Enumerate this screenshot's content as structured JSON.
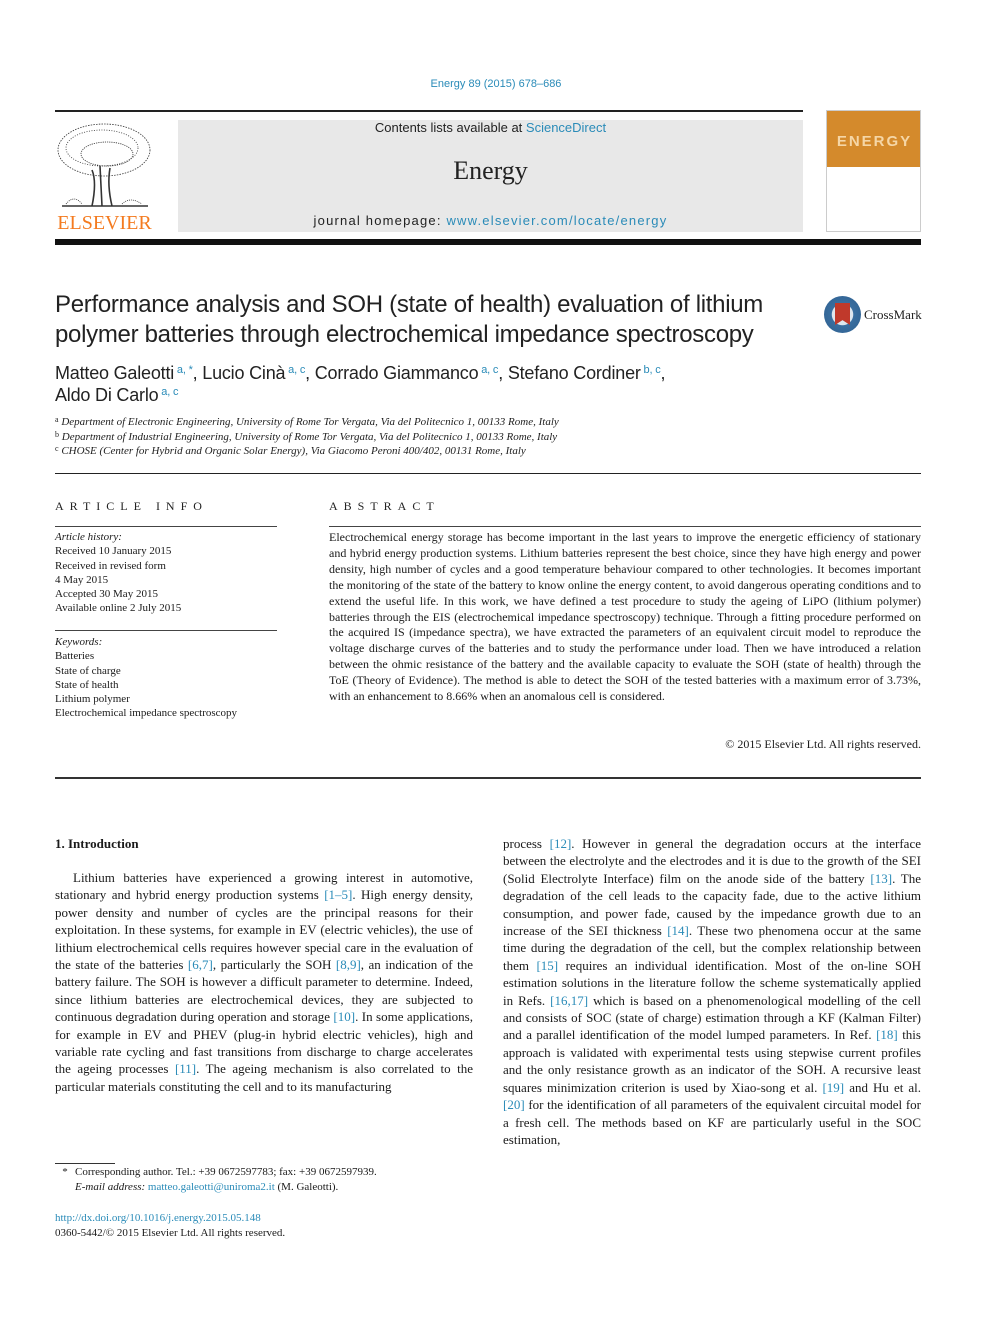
{
  "header": {
    "citation": "Energy 89 (2015) 678–686",
    "contents_prefix": "Contents lists available at ",
    "contents_link": "ScienceDirect",
    "journal_name": "Energy",
    "homepage_prefix": "journal homepage: ",
    "homepage_link": "www.elsevier.com/locate/energy",
    "publisher_logo_text": "ELSEVIER",
    "cover_title": "ENERGY",
    "crossmark_label": "CrossMark",
    "colors": {
      "link": "#2a8bb8",
      "elsevier_orange": "#f47b20",
      "cover_orange": "#d48a2c",
      "masthead_gray": "#e8e8e8"
    }
  },
  "article": {
    "title": "Performance analysis and SOH (state of health) evaluation of lithium polymer batteries through electrochemical impedance spectroscopy",
    "authors": [
      {
        "name": "Matteo Galeotti",
        "sup": "a, *",
        "sep": ", "
      },
      {
        "name": "Lucio Cinà",
        "sup": "a, c",
        "sep": ", "
      },
      {
        "name": "Corrado Giammanco",
        "sup": "a, c",
        "sep": ", "
      },
      {
        "name": "Stefano Cordiner",
        "sup": "b, c",
        "sep": ","
      },
      {
        "name": "Aldo Di Carlo",
        "sup": "a, c",
        "sep": ""
      }
    ],
    "affiliations": [
      {
        "key": "a",
        "text": "Department of Electronic Engineering, University of Rome Tor Vergata, Via del Politecnico 1, 00133 Rome, Italy"
      },
      {
        "key": "b",
        "text": "Department of Industrial Engineering, University of Rome Tor Vergata, Via del Politecnico 1, 00133 Rome, Italy"
      },
      {
        "key": "c",
        "text": "CHOSE (Center for Hybrid and Organic Solar Energy), Via Giacomo Peroni 400/402, 00131 Rome, Italy"
      }
    ]
  },
  "article_info": {
    "heading": "ARTICLE INFO",
    "history_label": "Article history:",
    "history": [
      "Received 10 January 2015",
      "Received in revised form",
      "4 May 2015",
      "Accepted 30 May 2015",
      "Available online 2 July 2015"
    ],
    "keywords_label": "Keywords:",
    "keywords": [
      "Batteries",
      "State of charge",
      "State of health",
      "Lithium polymer",
      "Electrochemical impedance spectroscopy"
    ]
  },
  "abstract": {
    "heading": "ABSTRACT",
    "text": "Electrochemical energy storage has become important in the last years to improve the energetic efficiency of stationary and hybrid energy production systems. Lithium batteries represent the best choice, since they have high energy and power density, high number of cycles and a good temperature behaviour compared to other technologies. It becomes important the monitoring of the state of the battery to know online the energy content, to avoid dangerous operating conditions and to extend the useful life. In this work, we have defined a test procedure to study the ageing of LiPO (lithium polymer) batteries through the EIS (electrochemical impedance spectroscopy) technique. Through a fitting procedure performed on the acquired IS (impedance spectra), we have extracted the parameters of an equivalent circuit model to reproduce the voltage discharge curves of the batteries and to study the performance under load. Then we have introduced a relation between the ohmic resistance of the battery and the available capacity to evaluate the SOH (state of health) through the ToE (Theory of Evidence). The method is able to detect the SOH of the tested batteries with a maximum error of 3.73%, with an enhancement to 8.66% when an anomalous cell is considered.",
    "copyright": "© 2015 Elsevier Ltd. All rights reserved."
  },
  "body": {
    "section_heading": "1.  Introduction",
    "left_column": [
      {
        "t": "Lithium batteries have experienced a growing interest in automotive, stationary and hybrid energy production systems "
      },
      {
        "ref": "[1–5]"
      },
      {
        "t": ". High energy density, power density and number of cycles are the principal reasons for their exploitation. In these systems, for example in EV (electric vehicles), the use of lithium electrochemical cells requires however special care in the evaluation of the state of the batteries "
      },
      {
        "ref": "[6,7]"
      },
      {
        "t": ", particularly the SOH "
      },
      {
        "ref": "[8,9]"
      },
      {
        "t": ", an indication of the battery failure. The SOH is however a difficult parameter to determine. Indeed, since lithium batteries are electrochemical devices, they are subjected to continuous degradation during operation and storage "
      },
      {
        "ref": "[10]"
      },
      {
        "t": ". In some applications, for example in EV and PHEV (plug-in hybrid electric vehicles), high and variable rate cycling and fast transitions from discharge to charge accelerates the ageing processes "
      },
      {
        "ref": "[11]"
      },
      {
        "t": ". The ageing mechanism is also correlated to the particular materials constituting the cell and to its manufacturing"
      }
    ],
    "right_column": [
      {
        "t": "process "
      },
      {
        "ref": "[12]"
      },
      {
        "t": ". However in general the degradation occurs at the interface between the electrolyte and the electrodes and it is due to the growth of the SEI (Solid Electrolyte Interface) film on the anode side of the battery "
      },
      {
        "ref": "[13]"
      },
      {
        "t": ". The degradation of the cell leads to the capacity fade, due to the active lithium consumption, and power fade, caused by the impedance growth due to an increase of the SEI thickness "
      },
      {
        "ref": "[14]"
      },
      {
        "t": ". These two phenomena occur at the same time during the degradation of the cell, but the complex relationship between them "
      },
      {
        "ref": "[15]"
      },
      {
        "t": " requires an individual identification. Most of the on-line SOH estimation solutions in the literature follow the scheme systematically applied in Refs. "
      },
      {
        "ref": "[16,17]"
      },
      {
        "t": " which is based on a phenomenological modelling of the cell and consists of SOC (state of charge) estimation through a KF (Kalman Filter) and a parallel identification of the model lumped parameters. In Ref. "
      },
      {
        "ref": "[18]"
      },
      {
        "t": " this approach is validated with experimental tests using stepwise current profiles and the only resistance growth as an indicator of the SOH. A recursive least squares minimization criterion is used by Xiao-song et al. "
      },
      {
        "ref": "[19]"
      },
      {
        "t": " and Hu et al. "
      },
      {
        "ref": "[20]"
      },
      {
        "t": " for the identification of all parameters of the equivalent circuital model for a fresh cell. The methods based on KF are particularly useful in the SOC estimation,"
      }
    ]
  },
  "footnotes": {
    "star": "*",
    "corresponding": "Corresponding author. Tel.: +39 0672597783; fax: +39 0672597939.",
    "email_label": "E-mail address: ",
    "email": "matteo.galeotti@uniroma2.it",
    "email_suffix": " (M. Galeotti).",
    "doi": "http://dx.doi.org/10.1016/j.energy.2015.05.148",
    "issn_line": "0360-5442/© 2015 Elsevier Ltd. All rights reserved."
  }
}
